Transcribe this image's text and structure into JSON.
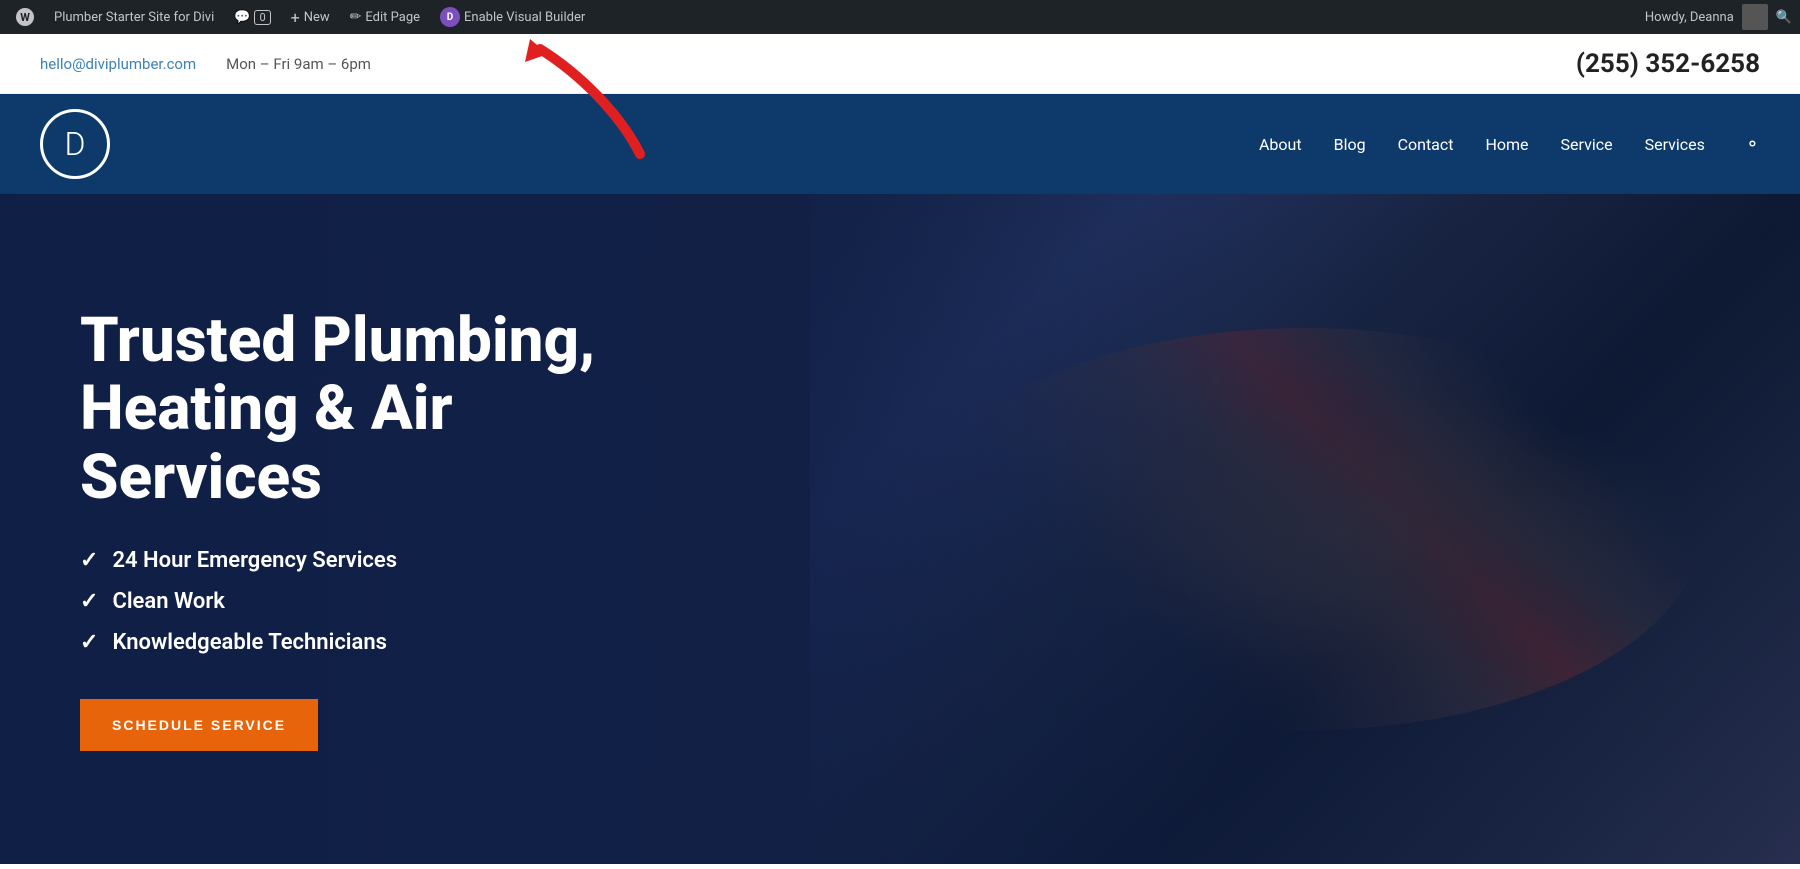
{
  "admin_bar": {
    "site_name": "Plumber Starter Site for Divi",
    "comments_count": "0",
    "new_label": "New",
    "edit_page_label": "Edit Page",
    "visual_builder_label": "Enable Visual Builder",
    "howdy_text": "Howdy, Deanna",
    "wp_icon": "W",
    "divi_letter": "D"
  },
  "top_bar": {
    "email": "hello@diviplumber.com",
    "hours": "Mon – Fri 9am – 6pm",
    "phone": "(255) 352-6258"
  },
  "nav": {
    "logo_letter": "D",
    "links": [
      {
        "label": "About",
        "href": "#"
      },
      {
        "label": "Blog",
        "href": "#"
      },
      {
        "label": "Contact",
        "href": "#"
      },
      {
        "label": "Home",
        "href": "#"
      },
      {
        "label": "Service",
        "href": "#"
      },
      {
        "label": "Services",
        "href": "#"
      }
    ]
  },
  "hero": {
    "title": "Trusted Plumbing, Heating & Air Services",
    "features": [
      "24 Hour Emergency Services",
      "Clean Work",
      "Knowledgeable Technicians"
    ],
    "cta_button": "Schedule Service"
  }
}
